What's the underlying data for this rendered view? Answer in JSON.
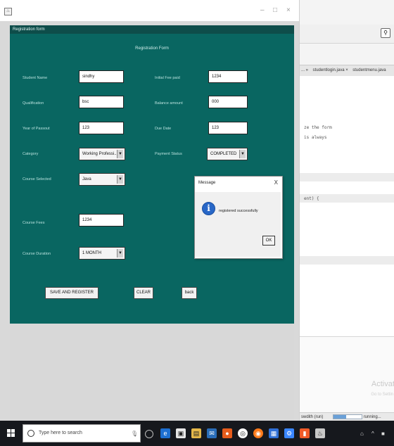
{
  "window": {
    "frame_title": "Registration form",
    "controls": {
      "minimize": "–",
      "maximize": "□",
      "close": "×"
    }
  },
  "form": {
    "heading": "Registration Form",
    "fields": {
      "student_name": {
        "label": "Student Name",
        "value": "sindhy"
      },
      "qualification": {
        "label": "Qualification",
        "value": "bsc"
      },
      "year_of_passout": {
        "label": "Year of Passout",
        "value": "123"
      },
      "category": {
        "label": "Category",
        "value": "Working Professi..."
      },
      "course_selected": {
        "label": "Course Selected",
        "value": "Java"
      },
      "course_fees": {
        "label": "Course Fees",
        "value": "1234"
      },
      "course_duration": {
        "label": "Course Duration",
        "value": "1 MONTH"
      },
      "initial_fee_paid": {
        "label": "Initial Fee paid",
        "value": "1234"
      },
      "balance_amount": {
        "label": "Balance amount",
        "value": "000"
      },
      "due_date": {
        "label": "Due Date",
        "value": "123"
      },
      "payment_status": {
        "label": "Payment Status",
        "value": "COMPLETED"
      }
    },
    "buttons": {
      "save_register": "SAVE AND REGISTER",
      "clear": "CLEAR",
      "back": "back"
    }
  },
  "dialog": {
    "title": "Message",
    "close": "X",
    "message": "registered successfully",
    "ok": "OK",
    "icon": "info-icon"
  },
  "ide": {
    "tabs": [
      "... »",
      "studentlogin.java ×",
      "studentmenu.java"
    ],
    "code_lines": [
      "ze the form",
      "is always",
      "ent) {"
    ],
    "status_left": "swdith (run)",
    "status_right": "running...",
    "progress": 0.45,
    "activate_title": "Activate",
    "activate_sub": "Go to Settin"
  },
  "taskbar": {
    "search_placeholder": "Type here to search",
    "app_icons": [
      "task-view",
      "edge",
      "store",
      "files",
      "mail",
      "media",
      "chrome",
      "firefox",
      "store2",
      "settings",
      "office",
      "java"
    ],
    "colors": {
      "accent": "#096661",
      "dialog_info": "#2867c7"
    }
  }
}
